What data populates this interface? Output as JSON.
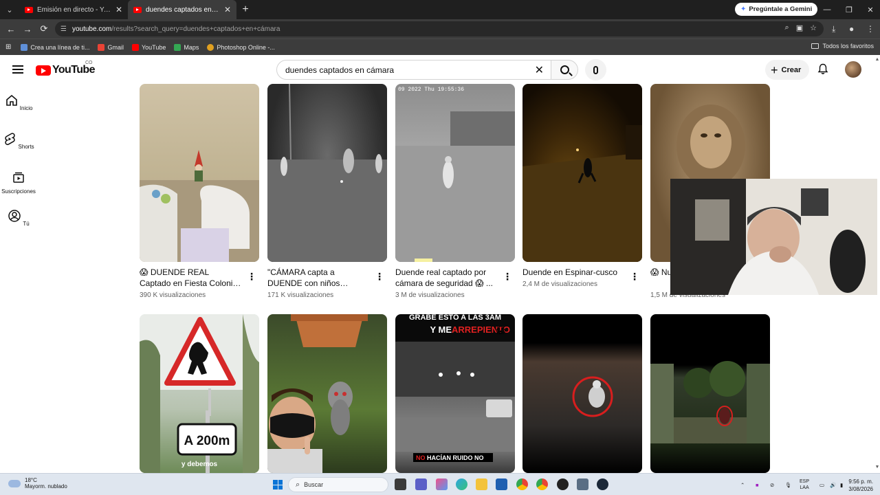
{
  "browser": {
    "tabs": [
      {
        "title": "Emisión en directo - YouTube Studio",
        "active": false
      },
      {
        "title": "duendes captados en cámara - YouTube",
        "active": true
      }
    ],
    "gemini_button": "Pregúntale a Gemini",
    "url": {
      "host": "youtube.com",
      "path": "/results?search_query=duendes+captados+en+cámara"
    },
    "bookmarks": [
      {
        "label": "Crea una línea de ti...",
        "color": "#5f8fd8"
      },
      {
        "label": "Gmail",
        "color": "#ea4335"
      },
      {
        "label": "YouTube",
        "color": "#ff0000"
      },
      {
        "label": "Maps",
        "color": "#34a853"
      },
      {
        "label": "Photoshop Online -...",
        "color": "#e0a020"
      }
    ],
    "all_bookmarks": "Todos los favoritos"
  },
  "youtube": {
    "logo_text": "YouTube",
    "country_code": "CO",
    "search_query": "duendes captados en cámara",
    "create_label": "Crear",
    "sidebar": [
      {
        "label": "Inicio",
        "icon": "home-icon"
      },
      {
        "label": "Shorts",
        "icon": "shorts-icon"
      },
      {
        "label": "Suscripciones",
        "icon": "subscriptions-icon"
      },
      {
        "label": "Tú",
        "icon": "you-icon"
      }
    ],
    "row1": [
      {
        "title": "😱 DUENDE REAL Captado en Fiesta Colonia El ...",
        "views": "390 K visualizaciones"
      },
      {
        "title": "\"CÁMARA capta a DUENDE con niños jugando\" #viral ...",
        "views": "171 K visualizaciones"
      },
      {
        "title": "Duende real captado por cámara de seguridad 😱 ...",
        "views": "3 M de visualizaciones"
      },
      {
        "title": "Duende en Espinar-cusco",
        "views": "2,4 M de visualizaciones"
      },
      {
        "title": "😱 Nu... real ‼",
        "views": "1,5 M de visualizaciones"
      }
    ],
    "row2_captions": {
      "sign": "A 200m",
      "sign_sub": "y debemos",
      "short3_top_white": "GRABÉ ESTO A LAS 3AM",
      "short3_line2_white": "Y ME ",
      "short3_line2_red": "ARREPIENTO",
      "short3_bottom_red": "NO",
      "short3_bottom_white": " HACÍAN RUIDO NO"
    },
    "thumb1_timestamp": "09 2022 Thu 19:55:36"
  },
  "taskbar": {
    "temperature": "18°C",
    "weather": "Mayorm. nublado",
    "search_label": "Buscar",
    "lang_top": "ESP",
    "lang_bottom": "LAA",
    "time": "9:56 p. m.",
    "date": "3/08/2026"
  }
}
